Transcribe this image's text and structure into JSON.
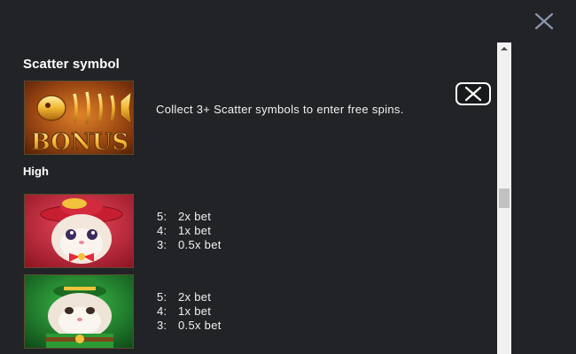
{
  "header": {
    "close_icon": "close-x-icon"
  },
  "scatter": {
    "title": "Scatter symbol",
    "tile_text": "BONUS",
    "description": "Collect 3+ Scatter symbols to enter free spins."
  },
  "high": {
    "title": "High",
    "symbols": [
      {
        "name": "cat-red-hat",
        "payouts": [
          {
            "count": "5:",
            "value": "2x bet"
          },
          {
            "count": "4:",
            "value": "1x bet"
          },
          {
            "count": "3:",
            "value": "0.5x bet"
          }
        ]
      },
      {
        "name": "cat-green-hat",
        "payouts": [
          {
            "count": "5:",
            "value": "2x bet"
          },
          {
            "count": "4:",
            "value": "1x bet"
          },
          {
            "count": "3:",
            "value": "0.5x bet"
          }
        ]
      }
    ]
  },
  "colors": {
    "background": "#222326",
    "text": "#ffffff",
    "scrollbar_track": "#f1f1f1",
    "scrollbar_thumb": "#c1c1c1"
  }
}
